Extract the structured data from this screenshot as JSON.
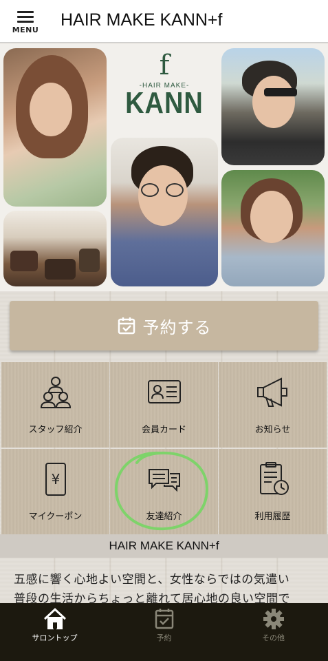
{
  "header": {
    "menu_label": "MENU",
    "title": "HAIR MAKE KANN+f"
  },
  "hero": {
    "logo": {
      "mark": "f",
      "sub": "-HAIR MAKE-",
      "name": "KANN"
    },
    "photos": [
      "portrait-woman-curly-hair",
      "salon-interior",
      "portrait-man-glasses",
      "portrait-man-sunglasses",
      "portrait-woman-outdoor"
    ]
  },
  "reserve_button": {
    "label": "予約する",
    "icon": "calendar-check-icon"
  },
  "menu_tiles": [
    {
      "label": "スタッフ紹介",
      "icon": "staff-icon"
    },
    {
      "label": "会員カード",
      "icon": "member-card-icon"
    },
    {
      "label": "お知らせ",
      "icon": "megaphone-icon"
    },
    {
      "label": "マイクーポン",
      "icon": "coupon-icon"
    },
    {
      "label": "友達紹介",
      "icon": "chat-bubbles-icon"
    },
    {
      "label": "利用履歴",
      "icon": "history-icon"
    }
  ],
  "section": {
    "title": "HAIR MAKE KANN+f",
    "description_line1": "五感に響く心地よい空間と、女性ならではの気遣い",
    "description_line2": "普段の生活からちょっと離れて居心地の良い空間で"
  },
  "tabbar": {
    "tabs": [
      {
        "label": "サロントップ",
        "icon": "home-icon",
        "active": true
      },
      {
        "label": "予約",
        "icon": "calendar-check-icon",
        "active": false
      },
      {
        "label": "その他",
        "icon": "gear-icon",
        "active": false
      }
    ]
  },
  "colors": {
    "accent_brown": "#c6b7a0",
    "tile_bg": "#c8bba7",
    "logo_green": "#2f5a40",
    "tabbar_bg": "#1c190f",
    "annotation_green": "#7ed36a"
  }
}
